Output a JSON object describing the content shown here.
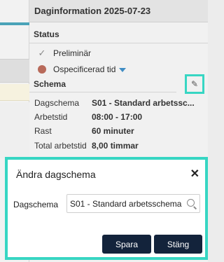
{
  "panel": {
    "title": "Daginformation 2025-07-23",
    "status": {
      "title": "Status",
      "items": [
        {
          "label": "Preliminär",
          "icon": "check-icon"
        },
        {
          "label": "Ospecificerad tid",
          "icon": "status-dot-icon",
          "color": "#b86a5a"
        }
      ]
    },
    "schema": {
      "title": "Schema",
      "rows": [
        {
          "label": "Dagschema",
          "value": "S01 - Standard arbetssc..."
        },
        {
          "label": "Arbetstid",
          "value": "08:00 - 17:00"
        },
        {
          "label": "Rast",
          "value": "60 minuter"
        },
        {
          "label": "Total arbetstid",
          "value": "8,00 timmar"
        }
      ]
    }
  },
  "modal": {
    "title": "Ändra dagschema",
    "field_label": "Dagschema",
    "field_value": "S01 - Standard arbetsschema",
    "save_label": "Spara",
    "close_label": "Stäng"
  },
  "colors": {
    "accent": "#37d6c3",
    "button": "#13233b",
    "dropdown_caret": "#3f8cc4"
  }
}
